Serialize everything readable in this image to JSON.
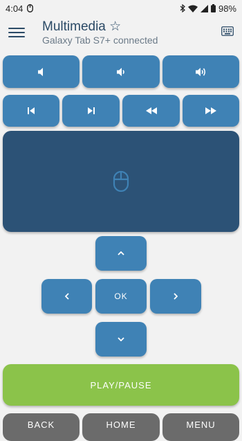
{
  "status": {
    "time": "4:04",
    "battery": "98%"
  },
  "header": {
    "title": "Multimedia ☆",
    "subtitle": "Galaxy Tab S7+ connected"
  },
  "dpad": {
    "ok_label": "OK"
  },
  "actions": {
    "play_pause": "PLAY/PAUSE",
    "back": "BACK",
    "home": "HOME",
    "menu": "MENU"
  },
  "colors": {
    "button": "#3f82b5",
    "touchpad": "#2c5276",
    "play": "#8bc34a",
    "nav_gray": "#6b6b6b",
    "text": "#2b4a66"
  }
}
